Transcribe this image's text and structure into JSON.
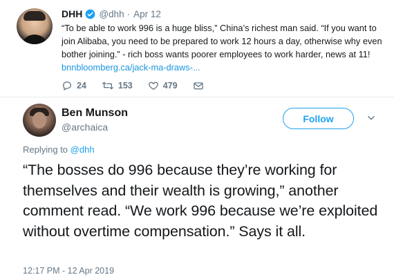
{
  "quoted_tweet": {
    "name": "DHH",
    "handle": "@dhh",
    "separator": "·",
    "date": "Apr 12",
    "text": "“To be able to work 996 is a huge bliss,” China’s richest man said. “If you want to join Alibaba, you need to be prepared to work 12 hours a day, otherwise why even bother joining.” - rich boss wants poorer employees to work harder, news at 11! ",
    "link": "bnnbloomberg.ca/jack-ma-draws-...",
    "actions": {
      "reply_icon": "reply-icon",
      "reply_count": "24",
      "retweet_icon": "retweet-icon",
      "retweet_count": "153",
      "like_icon": "heart-icon",
      "like_count": "479",
      "dm_icon": "envelope-icon"
    }
  },
  "main_tweet": {
    "author_name": "Ben Munson",
    "author_handle": "@archaica",
    "follow_label": "Follow",
    "replying_to_label": "Replying to ",
    "replying_to_handle": "@dhh",
    "text": "“The bosses do 996 because they’re working for themselves and their wealth is growing,” another comment read. “We work 996 because we’re exploited without overtime compensation.” Says it all.",
    "timestamp": "12:17 PM - 12 Apr 2019"
  },
  "colors": {
    "accent": "#1da1f2",
    "link": "#1b95e0",
    "secondary_text": "#657786",
    "primary_text": "#14171a"
  }
}
